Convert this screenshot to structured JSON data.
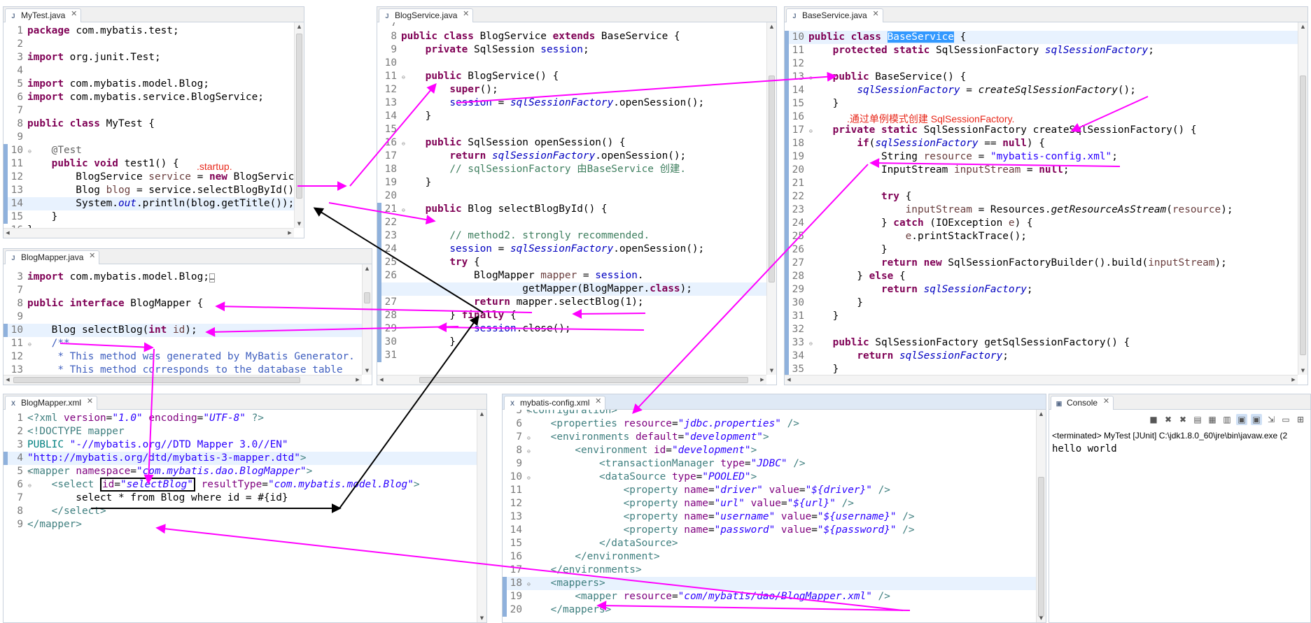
{
  "editors": {
    "mytest": {
      "tab": "MyTest.java",
      "lines": [
        {
          "n": "1",
          "h": "<span class='kw'>package</span> com.mybatis.test;"
        },
        {
          "n": "2",
          "h": ""
        },
        {
          "n": "3",
          "h": "<span class='kw'>import</span> org.junit.Test;",
          "fold": "⊖"
        },
        {
          "n": "4",
          "h": ""
        },
        {
          "n": "5",
          "h": "<span class='kw'>import</span> com.mybatis.model.Blog;"
        },
        {
          "n": "6",
          "h": "<span class='kw'>import</span> com.mybatis.service.BlogService;"
        },
        {
          "n": "7",
          "h": ""
        },
        {
          "n": "8",
          "h": "<span class='kw'>public class</span> MyTest {"
        },
        {
          "n": "9",
          "h": ""
        },
        {
          "n": "10",
          "h": "    <span class='ann'>@Test</span>",
          "fold": "⊖",
          "mk": true
        },
        {
          "n": "11",
          "h": "    <span class='kw'>public void</span> test1() {",
          "mk": true
        },
        {
          "n": "12",
          "h": "        BlogService <span class='lv'>service</span> = <span class='kw'>new</span> BlogService();",
          "mk": true
        },
        {
          "n": "13",
          "h": "        Blog <span class='lv'>blog</span> = service.selectBlogById();",
          "mk": true
        },
        {
          "n": "14",
          "h": "        System.<span class='sfld'>out</span>.println(blog.getTitle());",
          "mk": true,
          "hl": true
        },
        {
          "n": "15",
          "h": "    }",
          "mk": true
        },
        {
          "n": "16",
          "h": "}"
        }
      ]
    },
    "blogservice": {
      "tab": "BlogService.java",
      "lines": [
        {
          "n": "7",
          "h": ""
        },
        {
          "n": "8",
          "h": "<span class='kw'>public class</span> BlogService <span class='kw'>extends</span> BaseService {"
        },
        {
          "n": "9",
          "h": "    <span class='kw'>private</span> SqlSession <span class='fld'>session</span>;"
        },
        {
          "n": "10",
          "h": ""
        },
        {
          "n": "11",
          "h": "    <span class='kw'>public</span> BlogService() {",
          "fold": "⊖"
        },
        {
          "n": "12",
          "h": "        <span class='kw'>super</span>();"
        },
        {
          "n": "13",
          "h": "        <span class='fld'>session</span> = <span class='sfld'>sqlSessionFactory</span>.openSession();"
        },
        {
          "n": "14",
          "h": "    }"
        },
        {
          "n": "15",
          "h": ""
        },
        {
          "n": "16",
          "h": "    <span class='kw'>public</span> SqlSession openSession() {",
          "fold": "⊖"
        },
        {
          "n": "17",
          "h": "        <span class='kw'>return</span> <span class='sfld'>sqlSessionFactory</span>.openSession();"
        },
        {
          "n": "18",
          "h": "        <span class='cm'>// sqlSessionFactory 由BaseService 创建.</span>"
        },
        {
          "n": "19",
          "h": "    }"
        },
        {
          "n": "20",
          "h": ""
        },
        {
          "n": "21",
          "h": "    <span class='kw'>public</span> Blog selectBlogById() {",
          "fold": "⊖",
          "mk": true
        },
        {
          "n": "22",
          "h": "",
          "mk": true
        },
        {
          "n": "23",
          "h": "        <span class='cm'>// method2. strongly recommended.</span>",
          "mk": true
        },
        {
          "n": "24",
          "h": "        <span class='fld'>session</span> = <span class='sfld'>sqlSessionFactory</span>.openSession();",
          "mk": true
        },
        {
          "n": "25",
          "h": "        <span class='kw'>try</span> {",
          "mk": true
        },
        {
          "n": "26",
          "h": "            BlogMapper <span class='lv'>mapper</span> = <span class='fld'>session</span>.",
          "mk": true
        },
        {
          "n": "",
          "h": "                    getMapper(BlogMapper.<span class='kw'>class</span>);",
          "mk": true,
          "hl": true
        },
        {
          "n": "27",
          "h": "            <span class='kw'>return</span> mapper.selectBlog(1);",
          "mk": true
        },
        {
          "n": "28",
          "h": "        } <span class='kw'>finally</span> {",
          "mk": true
        },
        {
          "n": "29",
          "h": "            <span class='fld'>session</span>.close();",
          "mk": true
        },
        {
          "n": "30",
          "h": "        }",
          "mk": true
        },
        {
          "n": "31",
          "h": "",
          "mk": true
        }
      ]
    },
    "baseservice": {
      "tab": "BaseService.java",
      "lines": [
        {
          "n": "10",
          "h": "<span class='kw'>public class</span> <span class='sel'>BaseService</span> {",
          "mk": true,
          "hl": true
        },
        {
          "n": "11",
          "h": "    <span class='kw'>protected static</span> SqlSessionFactory <span class='sfld'>sqlSessionFactory</span>;",
          "mk": true
        },
        {
          "n": "12",
          "h": "",
          "mk": true
        },
        {
          "n": "13",
          "h": "    <span class='kw'>public</span> BaseService() {",
          "fold": "⊖",
          "mk": true
        },
        {
          "n": "14",
          "h": "        <span class='sfld'>sqlSessionFactory</span> = <span class='sm'>createSqlSessionFactory</span>();",
          "mk": true
        },
        {
          "n": "15",
          "h": "    }",
          "mk": true
        },
        {
          "n": "16",
          "h": "",
          "mk": true
        },
        {
          "n": "17",
          "h": "    <span class='kw'>private static</span> SqlSessionFactory createSqlSessionFactory() {",
          "fold": "⊖",
          "mk": true
        },
        {
          "n": "18",
          "h": "        <span class='kw'>if</span>(<span class='sfld'>sqlSessionFactory</span> == <span class='kw'>null</span>) {",
          "mk": true
        },
        {
          "n": "19",
          "h": "            String <span class='lv'>resource</span> = <span class='str'>\"mybatis-config.xml\"</span>;",
          "mk": true
        },
        {
          "n": "20",
          "h": "            InputStream <span class='lv'>inputStream</span> = <span class='kw'>null</span>;",
          "mk": true
        },
        {
          "n": "21",
          "h": "",
          "mk": true
        },
        {
          "n": "22",
          "h": "            <span class='kw'>try</span> {",
          "mk": true
        },
        {
          "n": "23",
          "h": "                <span class='lv'>inputStream</span> = Resources.<span class='sm'>getResourceAsStream</span>(<span class='lv'>resource</span>);",
          "mk": true
        },
        {
          "n": "24",
          "h": "            } <span class='kw'>catch</span> (IOException <span class='lv'>e</span>) {",
          "mk": true
        },
        {
          "n": "25",
          "h": "                <span class='lv'>e</span>.printStackTrace();",
          "mk": true
        },
        {
          "n": "26",
          "h": "            }",
          "mk": true
        },
        {
          "n": "27",
          "h": "            <span class='kw'>return new</span> SqlSessionFactoryBuilder().build(<span class='lv'>inputStream</span>);",
          "mk": true
        },
        {
          "n": "28",
          "h": "        } <span class='kw'>else</span> {",
          "mk": true
        },
        {
          "n": "29",
          "h": "            <span class='kw'>return</span> <span class='sfld'>sqlSessionFactory</span>;",
          "mk": true
        },
        {
          "n": "30",
          "h": "        }",
          "mk": true
        },
        {
          "n": "31",
          "h": "    }",
          "mk": true
        },
        {
          "n": "32",
          "h": "",
          "mk": true
        },
        {
          "n": "33",
          "h": "    <span class='kw'>public</span> SqlSessionFactory getSqlSessionFactory() {",
          "fold": "⊖",
          "mk": true
        },
        {
          "n": "34",
          "h": "        <span class='kw'>return</span> <span class='sfld'>sqlSessionFactory</span>;",
          "mk": true
        },
        {
          "n": "35",
          "h": "    }",
          "mk": true
        }
      ]
    },
    "blogmapperjava": {
      "tab": "BlogMapper.java",
      "lines": [
        {
          "n": "3",
          "h": "<span class='kw'>import</span> com.mybatis.model.Blog;<span style='border:1px solid #999;font-size:10px'>…</span>",
          "fold": "⊕"
        },
        {
          "n": "7",
          "h": ""
        },
        {
          "n": "8",
          "h": "<span class='kw'>public interface</span> BlogMapper {"
        },
        {
          "n": "9",
          "h": ""
        },
        {
          "n": "10",
          "h": "    Blog selectBlog(<span class='kw'>int</span> <span class='lv'>id</span>);",
          "mk": true,
          "hl": true
        },
        {
          "n": "11",
          "h": "    <span class='jd'>/**</span>",
          "fold": "⊖"
        },
        {
          "n": "12",
          "h": "<span class='jd'>     * This method was generated by MyBatis Generator.</span>"
        },
        {
          "n": "13",
          "h": "<span class='jd'>     * This method corresponds to the database table</span>"
        }
      ]
    },
    "blogmapperxml": {
      "tab": "BlogMapper.xml",
      "lines": [
        {
          "n": "1",
          "h": "<span class='tag'>&lt;?xml</span> <span class='attr'>version</span>=<span class='aval'>\"1.0\"</span> <span class='attr'>encoding</span>=<span class='aval'>\"UTF-8\"</span> <span class='tag'>?&gt;</span>"
        },
        {
          "n": "2",
          "h": "<span class='tag'>&lt;!DOCTYPE mapper</span>"
        },
        {
          "n": "3",
          "h": "<span class='dt'>PUBLIC</span> <span class='str'>\"-//mybatis.org//DTD Mapper 3.0//EN\"</span>"
        },
        {
          "n": "4",
          "h": "<span class='str'>\"http://mybatis.org/dtd/mybatis-3-mapper.dtd\"</span><span class='tag'>&gt;</span>",
          "mk": true,
          "hl": true
        },
        {
          "n": "5",
          "h": "<span class='tag'>&lt;mapper</span> <span class='attr'>namespace</span>=<span class='aval'>\"com.mybatis.dao.BlogMapper\"</span><span class='tag'>&gt;</span>",
          "fold": "⊖"
        },
        {
          "n": "6",
          "h": "    <span class='tag'>&lt;select</span> <span style='border:2px solid #000;padding:0 1px'><span class='attr'>id</span>=<span class='aval'>\"selectBlog\"</span></span> <span class='attr'>resultType</span>=<span class='aval'>\"com.mybatis.model.Blog\"</span><span class='tag'>&gt;</span>",
          "fold": "⊖"
        },
        {
          "n": "7",
          "h": "        select * from Blog where id = #{id}"
        },
        {
          "n": "8",
          "h": "    <span class='tag'>&lt;/select&gt;</span>"
        },
        {
          "n": "9",
          "h": "<span class='tag'>&lt;/mapper&gt;</span>"
        }
      ]
    },
    "mybatisconfig": {
      "tab": "mybatis-config.xml",
      "lines": [
        {
          "n": "5",
          "h": "<span class='tag'>&lt;configuration&gt;</span>",
          "fold": "⊖"
        },
        {
          "n": "6",
          "h": "    <span class='tag'>&lt;properties</span> <span class='attr'>resource</span>=<span class='aval'>\"jdbc.properties\"</span> <span class='tag'>/&gt;</span>"
        },
        {
          "n": "7",
          "h": "    <span class='tag'>&lt;environments</span> <span class='attr'>default</span>=<span class='aval'>\"development\"</span><span class='tag'>&gt;</span>",
          "fold": "⊖"
        },
        {
          "n": "8",
          "h": "        <span class='tag'>&lt;environment</span> <span class='attr'>id</span>=<span class='aval'>\"development\"</span><span class='tag'>&gt;</span>",
          "fold": "⊖"
        },
        {
          "n": "9",
          "h": "            <span class='tag'>&lt;transactionManager</span> <span class='attr'>type</span>=<span class='aval'>\"JDBC\"</span> <span class='tag'>/&gt;</span>"
        },
        {
          "n": "10",
          "h": "            <span class='tag'>&lt;dataSource</span> <span class='attr'>type</span>=<span class='aval'>\"POOLED\"</span><span class='tag'>&gt;</span>",
          "fold": "⊖"
        },
        {
          "n": "11",
          "h": "                <span class='tag'>&lt;property</span> <span class='attr'>name</span>=<span class='aval'>\"driver\"</span> <span class='attr'>value</span>=<span class='aval'>\"${driver}\"</span> <span class='tag'>/&gt;</span>"
        },
        {
          "n": "12",
          "h": "                <span class='tag'>&lt;property</span> <span class='attr'>name</span>=<span class='aval'>\"url\"</span> <span class='attr'>value</span>=<span class='aval'>\"${url}\"</span> <span class='tag'>/&gt;</span>"
        },
        {
          "n": "13",
          "h": "                <span class='tag'>&lt;property</span> <span class='attr'>name</span>=<span class='aval'>\"username\"</span> <span class='attr'>value</span>=<span class='aval'>\"${username}\"</span> <span class='tag'>/&gt;</span>"
        },
        {
          "n": "14",
          "h": "                <span class='tag'>&lt;property</span> <span class='attr'>name</span>=<span class='aval'>\"password\"</span> <span class='attr'>value</span>=<span class='aval'>\"${password}\"</span> <span class='tag'>/&gt;</span>"
        },
        {
          "n": "15",
          "h": "            <span class='tag'>&lt;/dataSource&gt;</span>"
        },
        {
          "n": "16",
          "h": "        <span class='tag'>&lt;/environment&gt;</span>"
        },
        {
          "n": "17",
          "h": "    <span class='tag'>&lt;/environments&gt;</span>"
        },
        {
          "n": "18",
          "h": "    <span class='tag'>&lt;mappers&gt;</span>",
          "fold": "⊖",
          "mk": true,
          "hl": true
        },
        {
          "n": "19",
          "h": "        <span class='tag'>&lt;mapper</span> <span class='attr'>resource</span>=<span class='aval'>\"com/mybatis/dao/BlogMapper.xml\"</span> <span class='tag'>/&gt;</span>",
          "mk": true
        },
        {
          "n": "20",
          "h": "    <span class='tag'>&lt;/mappers&gt;</span>",
          "mk": true
        }
      ]
    }
  },
  "console": {
    "tab": "Console",
    "status": "<terminated> MyTest [JUnit] C:\\jdk1.8.0_60\\jre\\bin\\javaw.exe (2",
    "output": "hello world"
  },
  "annotations": {
    "startup": ".startup.",
    "singleton": ".通过单例模式创建 SqlSessionFactory."
  },
  "colors": {
    "arrow_magenta": "#ff00ff",
    "arrow_black": "#000000",
    "note_red": "#e8291c"
  }
}
